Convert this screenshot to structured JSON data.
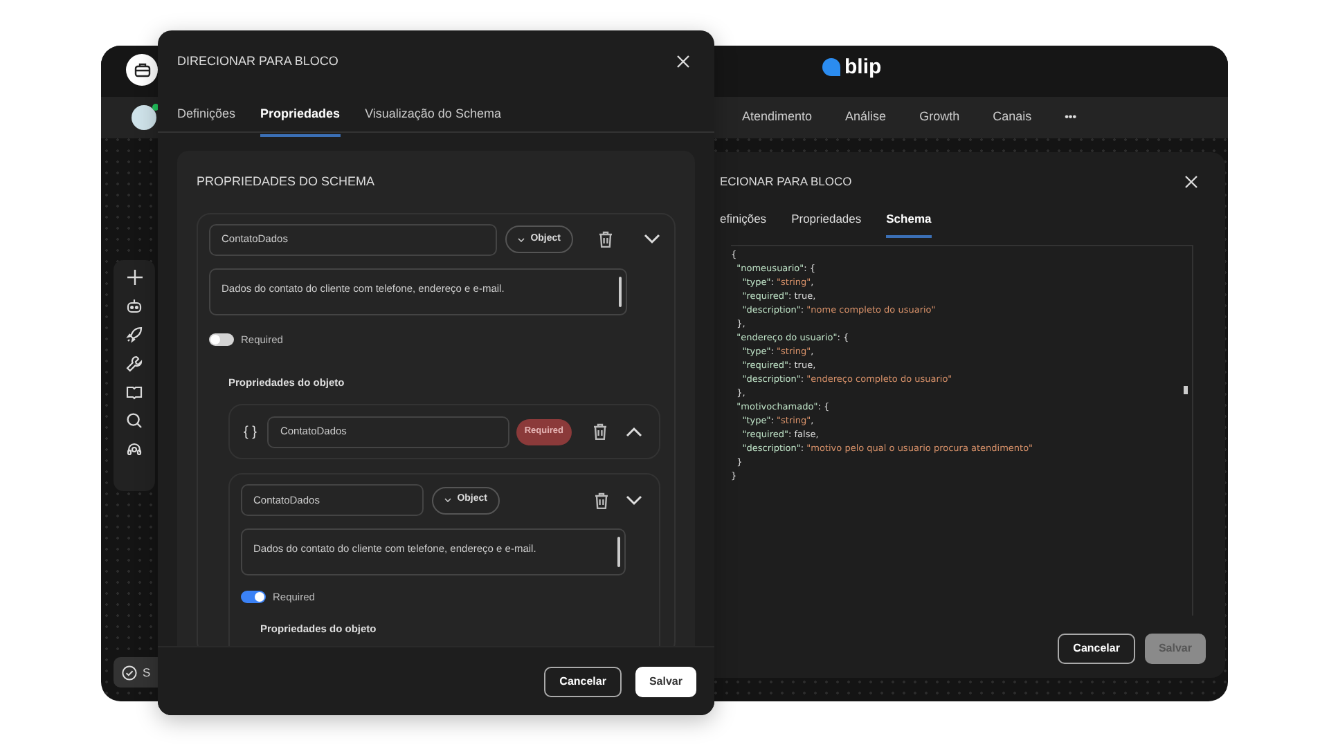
{
  "app": {
    "nav": [
      {
        "label": "Atendimento"
      },
      {
        "label": "Análise"
      },
      {
        "label": "Growth"
      },
      {
        "label": "Canais"
      }
    ],
    "more": "•••",
    "logo": "blip",
    "bottom_button": "S"
  },
  "schema_dialog": {
    "title": "ECIONAR PARA BLOCO",
    "tabs": [
      {
        "label": "efinições",
        "selected": false
      },
      {
        "label": "Propriedades",
        "selected": false
      },
      {
        "label": "Schema",
        "selected": true
      }
    ],
    "code_lines": [
      "{",
      "  \"nomeusuario\": {",
      "    \"type\": \"string\",",
      "    \"required\": true,",
      "    \"description\": \"nome completo do usuario\"",
      "  },",
      "  \"endereço do usuario\": {",
      "    \"type\": \"string\",",
      "    \"required\": true,",
      "    \"description\": \"endereço completo do usuario\"",
      "  },",
      "  \"motivochamado\": {",
      "    \"type\": \"string\",",
      "    \"required\": false,",
      "    \"description\": \"motivo pelo qual o usuario procura atendimento\"",
      "  }",
      "}"
    ],
    "buttons": [
      {
        "label": "Cancelar",
        "kind": "outline"
      },
      {
        "label": "Salvar",
        "kind": "solid",
        "disabled": true
      }
    ]
  },
  "properties_dialog": {
    "title": "DIRECIONAR PARA BLOCO",
    "tabs": [
      {
        "label": "Definições",
        "selected": false
      },
      {
        "label": "Propriedades",
        "selected": true
      },
      {
        "label": "Visualização do Schema",
        "selected": false
      }
    ],
    "panel_title": "PROPRIEDADES DO SCHEMA",
    "property": {
      "name": "ContatoDados",
      "type": "Object",
      "description": "Dados do contato do cliente com telefone, endereço e e-mail.",
      "required_label": "Required",
      "required": false,
      "expanded": false,
      "section_title": "Propriedades do objeto"
    },
    "child": {
      "icon": "{ }",
      "name": "ContatoDados",
      "badge": "Required",
      "expanded": true
    },
    "grandchild": {
      "name": "ContatoDados",
      "type": "Object",
      "description": "Dados do contato do cliente com telefone, endereço e e-mail.",
      "required_label": "Required",
      "required": true,
      "expanded": false,
      "section_title": "Propriedades do objeto"
    },
    "buttons": [
      {
        "label": "Cancelar",
        "kind": "outline"
      },
      {
        "label": "Salvar",
        "kind": "solid",
        "disabled": false
      }
    ]
  }
}
